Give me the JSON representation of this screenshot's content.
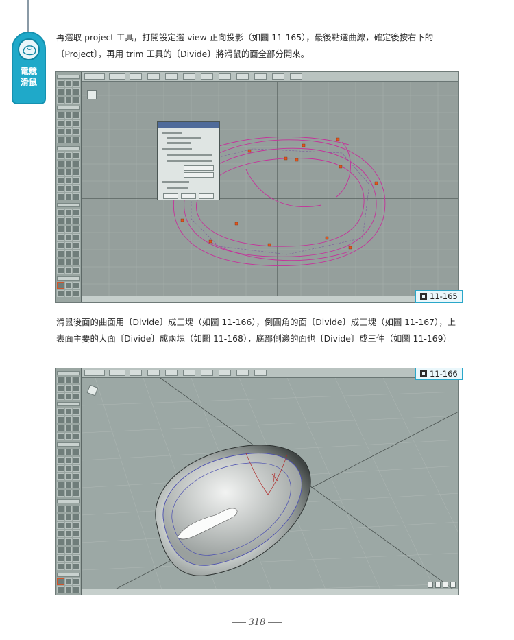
{
  "side_tab": {
    "label_line1": "電競",
    "label_line2": "滑鼠"
  },
  "paragraph1": "再選取 project 工具，打開設定選 view 正向投影（如圖 11-165），最後點選曲線，確定後按右下的〔Project〕，再用 trim 工具的〔Divide〕將滑鼠的面全部分開來。",
  "figure1": {
    "label": "11-165"
  },
  "paragraph2": "滑鼠後面的曲面用〔Divide〕成三塊（如圖 11-166），倒圓角的面〔Divide〕成三塊（如圖 11-167），上表面主要的大面〔Divide〕成兩塊（如圖 11-168），底部側邊的面也〔Divide〕成三件（如圖 11-169）。",
  "figure2": {
    "label": "11-166"
  },
  "page_number": "318",
  "colors": {
    "accent": "#1fa9c9",
    "curve": "#c4329a",
    "cv_point": "#e0571f"
  }
}
